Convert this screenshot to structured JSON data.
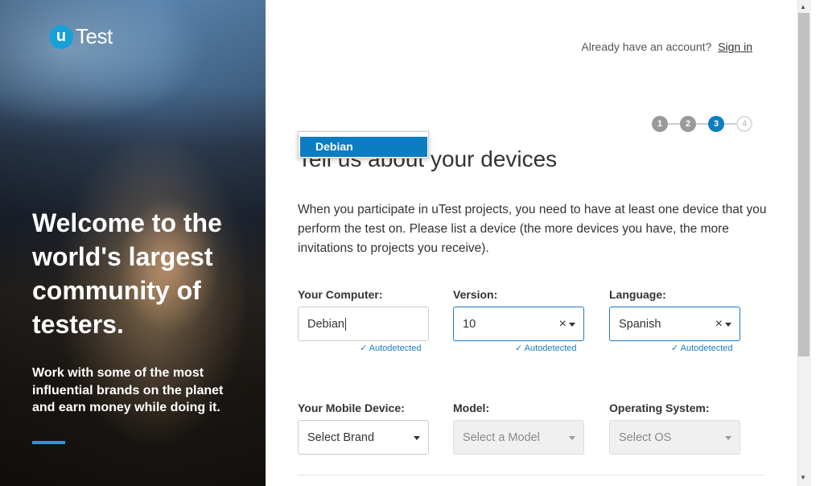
{
  "logo": {
    "badge": "u",
    "text": "Test"
  },
  "hero": {
    "title": "Welcome to the world's largest community of testers.",
    "subtitle": "Work with some of the most influential brands on the planet and earn money while doing it."
  },
  "header": {
    "account_prompt": "Already have an account?",
    "signin_label": "Sign in"
  },
  "steps": [
    {
      "number": "1",
      "state": "done"
    },
    {
      "number": "2",
      "state": "done"
    },
    {
      "number": "3",
      "state": "active"
    },
    {
      "number": "4",
      "state": "todo"
    }
  ],
  "page_title": "Tell us about your devices",
  "intro": "When you participate in uTest projects, you need to have at least one device that you perform the test on. Please list a device (the more devices you have, the more invitations to projects you receive).",
  "computer": {
    "computer_label": "Your Computer:",
    "computer_value": "Debian",
    "version_label": "Version:",
    "version_value": "10",
    "language_label": "Language:",
    "language_value": "Spanish",
    "autodetected": "Autodetected"
  },
  "mobile": {
    "device_label": "Your Mobile Device:",
    "device_value": "Select Brand",
    "model_label": "Model:",
    "model_value": "Select a Model",
    "os_label": "Operating System:",
    "os_value": "Select OS"
  },
  "dropdown": {
    "items": [
      "Debian"
    ]
  },
  "colors": {
    "accent": "#0b7dc0",
    "brand": "#1aa0d8"
  }
}
